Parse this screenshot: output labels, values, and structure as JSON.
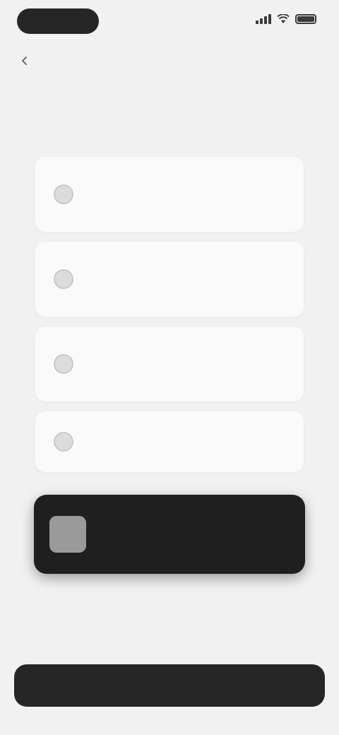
{
  "status_bar": {
    "time": "",
    "icons": [
      "signal-icon",
      "wifi-icon",
      "battery-icon"
    ]
  },
  "header": {
    "back_label": "",
    "title": "",
    "subtitle": ""
  },
  "options": [
    {
      "title": "",
      "description": "",
      "icon": "radio-icon"
    },
    {
      "title": "",
      "description": "",
      "icon": "radio-icon"
    },
    {
      "title": "",
      "description": "",
      "icon": "radio-icon"
    },
    {
      "title": "",
      "description": "",
      "icon": "radio-icon"
    }
  ],
  "toast": {
    "title": "",
    "message": ""
  },
  "skip_label": "",
  "continue_label": "",
  "colors": {
    "background": "#f1f1f1",
    "card": "#fafafa",
    "dark": "#1f1f1f"
  }
}
